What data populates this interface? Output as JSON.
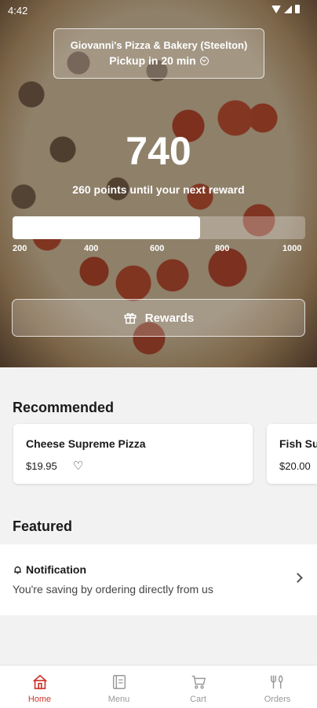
{
  "status": {
    "time": "4:42"
  },
  "store": {
    "name": "Giovanni's Pizza & Bakery (Steelton)",
    "pickup": "Pickup in 20 min"
  },
  "rewards": {
    "points": "740",
    "subtitle": "260 points until your next reward",
    "progress_fraction": 0.64,
    "ticks": [
      "200",
      "400",
      "600",
      "800",
      "1000"
    ],
    "button_label": "Rewards"
  },
  "recommended": {
    "title": "Recommended",
    "items": [
      {
        "name": "Cheese Supreme Pizza",
        "price": "$19.95"
      },
      {
        "name": "Fish Su",
        "price": "$20.00"
      }
    ]
  },
  "featured": {
    "title": "Featured",
    "notification_title": "Notification",
    "notification_body": "You're saving by ordering directly from us"
  },
  "nav": {
    "items": [
      {
        "label": "Home",
        "icon": "home-icon"
      },
      {
        "label": "Menu",
        "icon": "menu-icon"
      },
      {
        "label": "Cart",
        "icon": "cart-icon"
      },
      {
        "label": "Orders",
        "icon": "orders-icon"
      }
    ],
    "active": "Home",
    "active_color": "#d0352b"
  }
}
